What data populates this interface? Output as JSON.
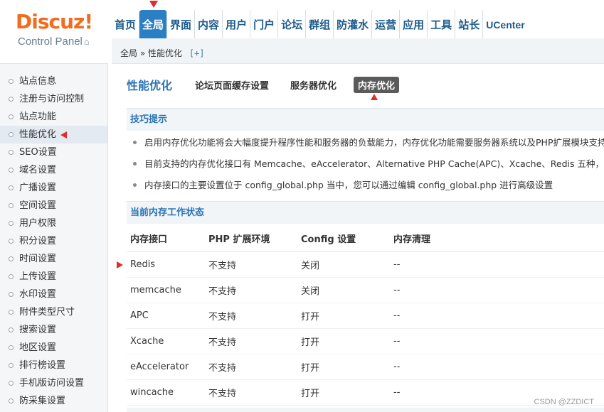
{
  "logo": {
    "brand": "Discuz!",
    "subtitle": "Control Panel",
    "home_icon": "⌂"
  },
  "topnav": [
    {
      "label": "首页"
    },
    {
      "label": "全局",
      "active": true
    },
    {
      "label": "界面"
    },
    {
      "label": "内容"
    },
    {
      "label": "用户"
    },
    {
      "label": "门户"
    },
    {
      "label": "论坛"
    },
    {
      "label": "群组"
    },
    {
      "label": "防灌水"
    },
    {
      "label": "运营"
    },
    {
      "label": "应用"
    },
    {
      "label": "工具"
    },
    {
      "label": "站长"
    },
    {
      "label": "UCenter"
    }
  ],
  "breadcrumb": {
    "root": "全局",
    "separator": "»",
    "current": "性能优化",
    "add": "[+]"
  },
  "sidebar": {
    "items": [
      "站点信息",
      "注册与访问控制",
      "站点功能",
      "性能优化",
      "SEO设置",
      "域名设置",
      "广播设置",
      "空间设置",
      "用户权限",
      "积分设置",
      "时间设置",
      "上传设置",
      "水印设置",
      "附件类型尺寸",
      "搜索设置",
      "地区设置",
      "排行榜设置",
      "手机版访问设置",
      "防采集设置"
    ],
    "active_index": 3
  },
  "page": {
    "title": "性能优化",
    "tabs": [
      {
        "label": "论坛页面缓存设置"
      },
      {
        "label": "服务器优化"
      },
      {
        "label": "内存优化",
        "active": true
      }
    ]
  },
  "tips": {
    "heading": "技巧提示",
    "items": [
      "启用内存优化功能将会大幅度提升程序性能和服务器的负载能力，内存优化功能需要服务器系统以及PHP扩展模块支持",
      "目前支持的内存优化接口有 Memcache、eAccelerator、Alternative PHP Cache(APC)、Xcache、Redis 五种，优化系",
      "内存接口的主要设置位于 config_global.php 当中，您可以通过编辑 config_global.php 进行高级设置"
    ]
  },
  "status": {
    "heading": "当前内存工作状态",
    "columns": [
      "内存接口",
      "PHP 扩展环境",
      "Config 设置",
      "内存清理"
    ],
    "rows": [
      [
        "Redis",
        "不支持",
        "关闭",
        "--"
      ],
      [
        "memcache",
        "不支持",
        "关闭",
        "--"
      ],
      [
        "APC",
        "不支持",
        "打开",
        "--"
      ],
      [
        "Xcache",
        "不支持",
        "打开",
        "--"
      ],
      [
        "eAccelerator",
        "不支持",
        "打开",
        "--"
      ],
      [
        "wincache",
        "不支持",
        "打开",
        "--"
      ]
    ]
  },
  "watermark": "CSDN @ZZDICT",
  "colors": {
    "accent": "#2a74b5",
    "brand": "#f26c20",
    "nav_active": "#2b7fc3",
    "marker": "#e42b2b"
  }
}
